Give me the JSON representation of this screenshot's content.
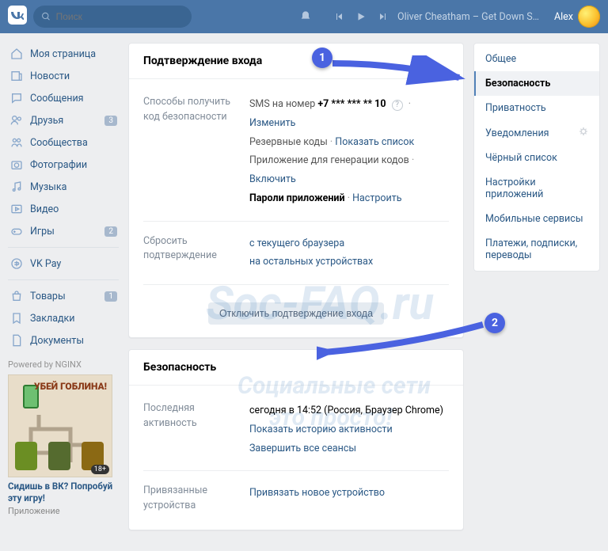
{
  "header": {
    "search_placeholder": "Поиск",
    "now_playing": "Oliver Cheatham – Get Down Saturd...",
    "username": "Alex"
  },
  "left_nav": {
    "items": [
      {
        "label": "Моя страница",
        "icon": "home"
      },
      {
        "label": "Новости",
        "icon": "news"
      },
      {
        "label": "Сообщения",
        "icon": "chat"
      },
      {
        "label": "Друзья",
        "icon": "friends",
        "badge": "3"
      },
      {
        "label": "Сообщества",
        "icon": "groups"
      },
      {
        "label": "Фотографии",
        "icon": "photo"
      },
      {
        "label": "Музыка",
        "icon": "music"
      },
      {
        "label": "Видео",
        "icon": "video"
      },
      {
        "label": "Игры",
        "icon": "games",
        "badge": "2"
      }
    ],
    "items2": [
      {
        "label": "VK Pay",
        "icon": "pay"
      }
    ],
    "items3": [
      {
        "label": "Товары",
        "icon": "market",
        "badge": "1"
      },
      {
        "label": "Закладки",
        "icon": "bookmark"
      },
      {
        "label": "Документы",
        "icon": "docs"
      }
    ],
    "powered": "Powered by NGINX",
    "ad": {
      "banner_caption": "УБЕЙ ГОБЛИНА!",
      "title": "Сидишь в ВК? Попробуй эту игру!",
      "subtitle": "Приложение",
      "age": "18+"
    }
  },
  "sections": {
    "confirm": {
      "title": "Подтверждение входа",
      "ways_label": "Способы получить код безопасности",
      "sms_label": "SMS на номер",
      "phone": "+7 *** *** ** 10",
      "change": "Изменить",
      "backup_label": "Резервные коды",
      "show_list": "Показать список",
      "apps_label": "Приложение для генерации кодов",
      "enable": "Включить",
      "app_pw_label": "Пароли приложений",
      "configure": "Настроить",
      "reset_label": "Сбросить подтверждение",
      "reset_current": "с текущего браузера",
      "reset_others": "на остальных устройствах",
      "disable_btn": "Отключить подтверждение входа"
    },
    "security": {
      "title": "Безопасность",
      "activity_label": "Последняя активность",
      "activity_value": "сегодня в 14:52 (Россия, Браузер Chrome)",
      "show_history": "Показать историю активности",
      "end_all": "Завершить все сеансы",
      "devices_label": "Привязанные устройства",
      "bind_new": "Привязать новое устройство"
    }
  },
  "settings_nav": {
    "items": [
      {
        "label": "Общее"
      },
      {
        "label": "Безопасность",
        "active": true
      },
      {
        "label": "Приватность"
      },
      {
        "label": "Уведомления",
        "gear": true
      },
      {
        "label": "Чёрный список"
      },
      {
        "label": "Настройки приложений"
      },
      {
        "label": "Мобильные сервисы"
      },
      {
        "label": "Платежи, подписки, переводы"
      }
    ]
  },
  "annotations": {
    "one": "1",
    "two": "2"
  },
  "watermark": {
    "brand": "Soc-FAQ.ru",
    "line1": "Социальные сети",
    "line2": "это просто!"
  }
}
